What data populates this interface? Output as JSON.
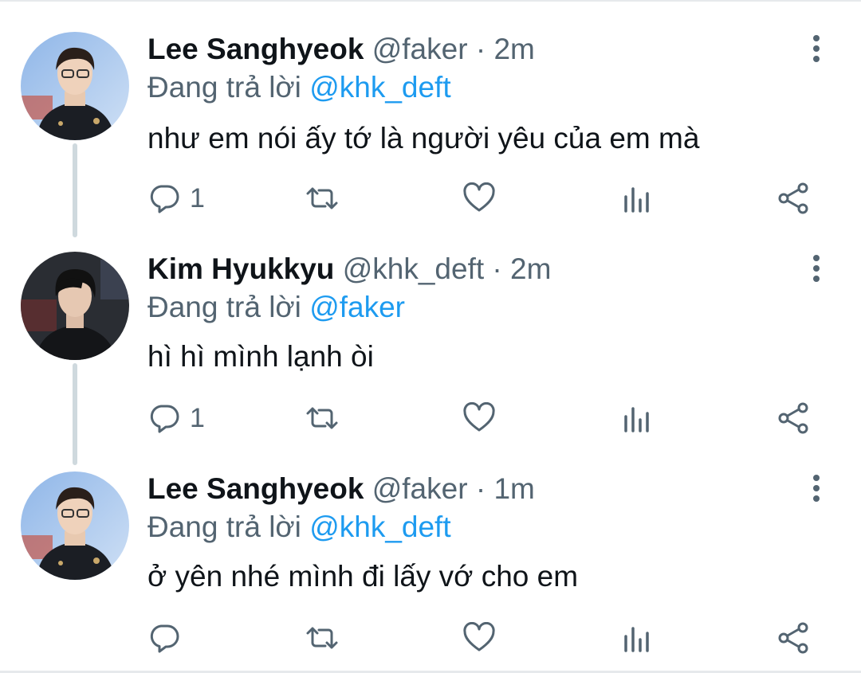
{
  "tweets": [
    {
      "name": "Lee Sanghyeok",
      "handle": "@faker",
      "separator": "·",
      "time": "2m",
      "reply_prefix": "Đang trả lời",
      "reply_to": "@khk_deft",
      "text": "như em nói ấy tớ là người yêu của em mà",
      "reply_count": "1",
      "avatar": "faker-avatar"
    },
    {
      "name": "Kim Hyukkyu",
      "handle": "@khk_deft",
      "separator": "·",
      "time": "2m",
      "reply_prefix": "Đang trả lời",
      "reply_to": "@faker",
      "text": "hì hì mình lạnh òi",
      "reply_count": "1",
      "avatar": "deft-avatar"
    },
    {
      "name": "Lee Sanghyeok",
      "handle": "@faker",
      "separator": "·",
      "time": "1m",
      "reply_prefix": "Đang trả lời",
      "reply_to": "@khk_deft",
      "text": "ở yên nhé mình đi lấy vớ cho em",
      "reply_count": "",
      "avatar": "faker-avatar"
    }
  ],
  "icons": {
    "reply": "reply-icon",
    "retweet": "retweet-icon",
    "like": "like-icon",
    "analytics": "analytics-icon",
    "share": "share-icon",
    "more": "more-options-icon"
  },
  "colors": {
    "text": "#0f1419",
    "secondary": "#536471",
    "mention": "#1d9bf0",
    "thread_line": "#cfd9de"
  }
}
